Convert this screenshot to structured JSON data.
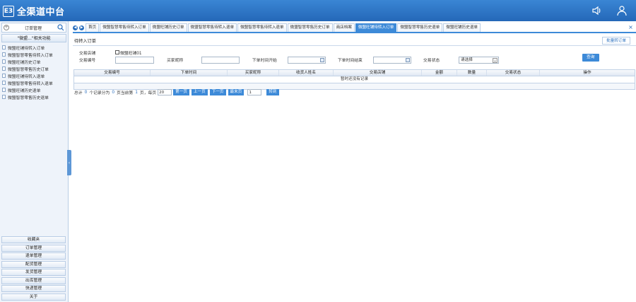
{
  "app": {
    "logo_text": "E3",
    "title": "全渠道中台"
  },
  "sidebar": {
    "search_label": "订单管理",
    "section_title": "\"微盟...\"相关功能",
    "items": [
      "微盟旺铺待转入订单",
      "微盟智慧零售待转入订单",
      "微盟旺铺历史订单",
      "微盟智慧零售历史订单",
      "微盟旺铺待转入退单",
      "微盟智慧零售待转入退单",
      "微盟旺铺历史退单",
      "微盟智慧零售历史退单"
    ],
    "bottom": [
      "收藏夹",
      "订单管理",
      "退单管理",
      "配货管理",
      "发货管理",
      "出库管理",
      "快递管理",
      "关于"
    ]
  },
  "tabs": {
    "items": [
      "首页",
      "微盟智慧零售待转入订单",
      "微盟旺铺历史订单",
      "微盟智慧零售待转入退单",
      "微盟智慧零售待转入退单",
      "微盟智慧零售历史订单",
      "商店档案",
      "微盟旺铺待转入订单",
      "微盟智慧零售历史退单",
      "微盟旺铺历史退单"
    ],
    "active_index": 7,
    "close": "×"
  },
  "main": {
    "title": "待转入订单",
    "batch_label": "批量转订单",
    "form": {
      "shop_label": "交易店铺",
      "shop_option": "微盟旺铺01",
      "trade_no_label": "交易编号",
      "buyer_label": "买家昵称",
      "start_label": "下单时间开始",
      "end_label": "下单时间结束",
      "status_label": "交易状态",
      "status_value": "请选择",
      "query_label": "查询"
    },
    "table": {
      "columns": [
        "交易编号",
        "下单时间",
        "买家昵称",
        "收货人姓名",
        "交易店铺",
        "金额",
        "数量",
        "交易状态",
        "操作"
      ],
      "empty": "暂时还没有记录"
    },
    "pager": {
      "total_label": "总计",
      "total": "0",
      "records_label": "个记录分为",
      "pages": "0",
      "pages_label": "页当前第",
      "current": "1",
      "page_suffix": "页，每页",
      "page_size": "20",
      "first": "第一页",
      "prev": "上一页",
      "next": "下一页",
      "last": "最末页",
      "jump_value": "1",
      "go": "转到"
    }
  }
}
